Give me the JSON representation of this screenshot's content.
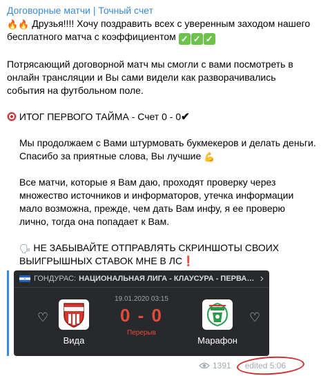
{
  "post": {
    "channel_title": "Договорные матчи | Точный счет",
    "p1": "Друзья!!!! Хочу поздравить всех с уверенным заходом нашего бесплатного матча с коэффициентом",
    "p2": "Потрясающий договорной матч мы смогли с вами посмотреть в онлайн трансляции и Вы сами видели как разворачивались события на футбольном поле.",
    "p3": "ИТОГ ПЕРВОГО ТАЙМА - Счет 0 - 0",
    "p4": "Мы продолжаем с Вами штурмовать букмекеров и делать деньги.",
    "p5": "Спасибо за приятные слова, Вы лучшие",
    "p6": "Все матчи, которые я Вам даю, проходят проверку через множество источников и информаторов, утечка информации мало возможна, прежде, чем дать Вам инфу, я ее проверю лично, тогда она попадает к Вам.",
    "p7": "НЕ ЗАБЫВАЙТЕ ОТПРАВЛЯТЬ СКРИНШОТЫ СВОИХ ВЫИГРЫШНЫХ СТАВОК МНЕ В ЛС"
  },
  "match_card": {
    "country": "ГОНДУРАС:",
    "league": "НАЦИОНАЛЬНАЯ ЛИГА - КЛАУСУРА - ПЕРВАЯ СТАД...",
    "date": "19.01.2020 03:15",
    "score": "0 - 0",
    "period": "Перерыв",
    "home_team": "Вида",
    "away_team": "Марафон"
  },
  "footer": {
    "views": "1391",
    "edited": "edited 5:06"
  },
  "icons": {
    "fire": "fire-icon",
    "check_box": "check-mark-button-icon",
    "target": "direct-hit-icon",
    "checkmark": "heavy-check-mark-icon",
    "arm": "flexed-biceps-icon",
    "speaking_head": "speaking-head-icon",
    "exclamation": "red-exclamation-icon",
    "eye": "eye-icon",
    "heart": "heart-icon",
    "chevron": "chevron-right-icon"
  },
  "colors": {
    "channel_title": "#3a8ad6",
    "card_bg": "#27292c",
    "score": "#e34b3a",
    "edited_circle": "#d22b2b"
  }
}
